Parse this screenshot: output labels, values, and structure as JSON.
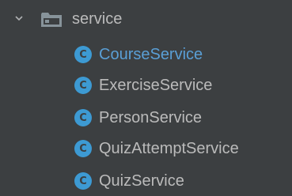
{
  "folder": {
    "label": "service",
    "icon": "folder-icon",
    "expanded": true
  },
  "items": [
    {
      "label": "CourseService",
      "icon": "class-icon",
      "icon_letter": "C",
      "highlighted": true
    },
    {
      "label": "ExerciseService",
      "icon": "class-icon",
      "icon_letter": "C",
      "highlighted": false
    },
    {
      "label": "PersonService",
      "icon": "class-icon",
      "icon_letter": "C",
      "highlighted": false
    },
    {
      "label": "QuizAttemptService",
      "icon": "class-icon",
      "icon_letter": "C",
      "highlighted": false
    },
    {
      "label": "QuizService",
      "icon": "class-icon",
      "icon_letter": "C",
      "highlighted": false
    }
  ],
  "colors": {
    "background": "#3c3f41",
    "text": "#bbbbbb",
    "highlight_text": "#5a9fd6",
    "class_icon": "#3d9ad3"
  }
}
